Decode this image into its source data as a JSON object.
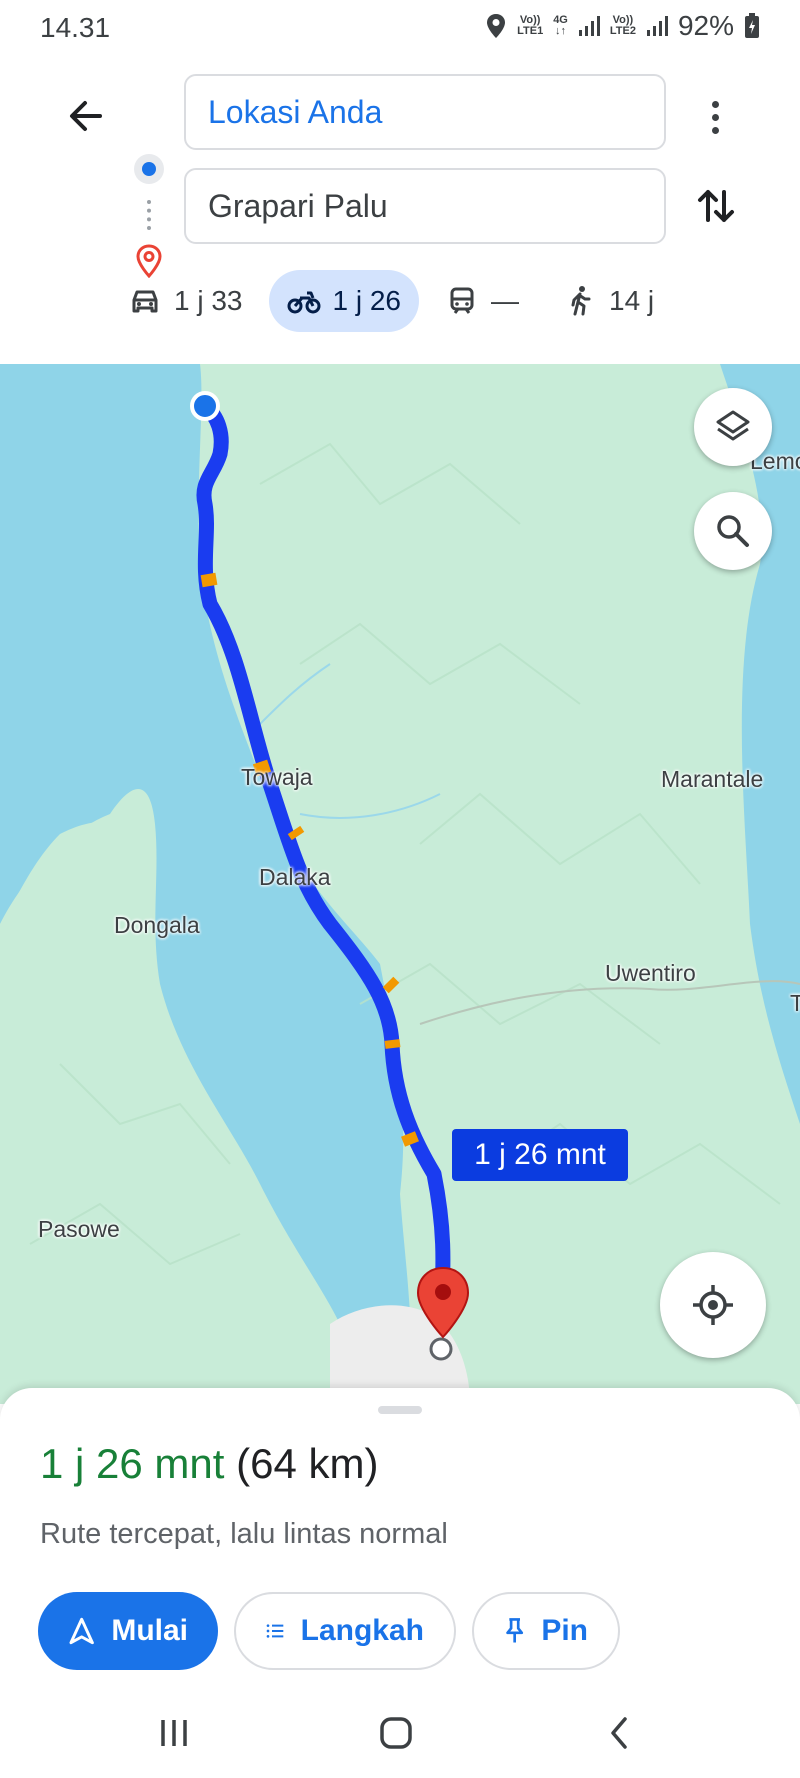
{
  "status_bar": {
    "time": "14.31",
    "sim1_top": "Vo))",
    "sim1_bottom": "LTE1",
    "network": "4G",
    "sim2_top": "Vo))",
    "sim2_bottom": "LTE2",
    "battery": "92%"
  },
  "route": {
    "origin": "Lokasi Anda",
    "destination": "Grapari Palu"
  },
  "modes": [
    {
      "icon": "car-icon",
      "label": "1 j 33"
    },
    {
      "icon": "motorcycle-icon",
      "label": "1 j 26",
      "selected": true
    },
    {
      "icon": "transit-icon",
      "label": "—"
    },
    {
      "icon": "walk-icon",
      "label": "14 j"
    }
  ],
  "map": {
    "places": {
      "lemo": "Lemo",
      "towaja": "Towaja",
      "marantale": "Marantale",
      "dalaka": "Dalaka",
      "dongala": "Dongala",
      "uwentiro": "Uwentiro",
      "pasowe": "Pasowe",
      "edge": "T"
    },
    "route_chip": "1 j 26 mnt",
    "route_color": "#1a3cf0",
    "water_color": "#8fd4e8",
    "land_color": "#c8ecd8"
  },
  "sheet": {
    "eta": "1 j 26 mnt",
    "distance": "(64 km)",
    "description": "Rute tercepat, lalu lintas normal",
    "start_label": "Mulai",
    "steps_label": "Langkah",
    "pin_label": "Pin"
  },
  "colors": {
    "accent": "#1a73e8",
    "eta_green": "#188038",
    "selected_mode_bg": "#d3e3fd",
    "pin_red": "#ea4335"
  }
}
